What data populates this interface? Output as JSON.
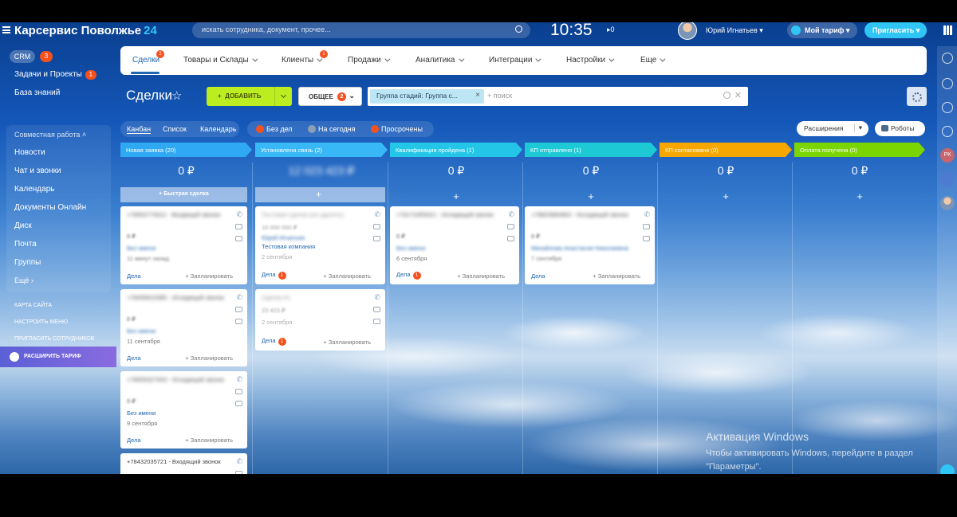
{
  "topbar": {
    "logo": "Карсервис Поволжье",
    "logo_num": "24",
    "search_placeholder": "искать сотрудника, документ, прочее...",
    "clock": "10:35",
    "flag_count": "0",
    "user_name": "Юрий Игнатьев",
    "tariff_label": "Мой тариф",
    "invite_label": "Пригласить"
  },
  "sidebar": {
    "crm_label": "CRM",
    "crm_badge": "3",
    "items": [
      {
        "label": "Задачи и Проекты",
        "badge": "1"
      },
      {
        "label": "База знаний"
      },
      {
        "label": "Совместная работа"
      },
      {
        "label": "Новости"
      },
      {
        "label": "Чат и звонки"
      },
      {
        "label": "Календарь"
      },
      {
        "label": "Документы Онлайн"
      },
      {
        "label": "Диск"
      },
      {
        "label": "Почта"
      },
      {
        "label": "Группы"
      },
      {
        "label": "Ещё"
      }
    ],
    "small_links": [
      "КАРТА САЙТА",
      "НАСТРОИТЬ МЕНЮ",
      "ПРИГЛАСИТЬ СОТРУДНИКОВ"
    ],
    "upgrade_label": "РАСШИРИТЬ ТАРИФ"
  },
  "nav": {
    "tabs": [
      {
        "label": "Сделки",
        "badge": "2"
      },
      {
        "label": "Товары и Склады"
      },
      {
        "label": "Клиенты",
        "badge": "1"
      },
      {
        "label": "Продажи"
      },
      {
        "label": "Аналитика"
      },
      {
        "label": "Интеграции"
      },
      {
        "label": "Настройки"
      },
      {
        "label": "Еще"
      }
    ]
  },
  "toolbar": {
    "title": "Сделки",
    "add_label": "ДОБАВИТЬ",
    "common_label": "ОБЩЕЕ",
    "common_badge": "2",
    "filter_tag": "Группа стадий: Группа с...",
    "filter_placeholder": "+ поиск"
  },
  "viewbar": {
    "views": [
      "Канбан",
      "Список",
      "Календарь"
    ],
    "counters": [
      {
        "label": "Без дел"
      },
      {
        "label": "На сегодня"
      },
      {
        "label": "Просрочены"
      }
    ],
    "extensions_label": "Расширения",
    "robots_label": "Роботы"
  },
  "columns": [
    {
      "name": "Новая заявка",
      "count": "(20)",
      "color": "#2fa9f4",
      "sum": "0 ₽"
    },
    {
      "name": "Установлена связь",
      "count": "(2)",
      "color": "#39b8f7",
      "sum": "12 023 423 ₽"
    },
    {
      "name": "Квалификация пройдена",
      "count": "(1)",
      "color": "#24c6e8",
      "sum": "0 ₽"
    },
    {
      "name": "КП отправлено",
      "count": "(1)",
      "color": "#1ec9d6",
      "sum": "0 ₽"
    },
    {
      "name": "КП согласовано",
      "count": "(0)",
      "color": "#f7a700",
      "sum": "0 ₽"
    },
    {
      "name": "Оплата получена",
      "count": "(0)",
      "color": "#7bd500",
      "sum": "0 ₽"
    }
  ],
  "quick_deal": "Быстрая сделка",
  "cards": {
    "c1": {
      "title": "+79002776311 - Входящий звонок",
      "sum": "0 ₽",
      "link": "Без имени",
      "date": "11 минут назад"
    },
    "c2": {
      "title": "+78435615385 - Исходящий звонок",
      "sum": "0 ₽",
      "link": "Без имени",
      "date": "11 сентября"
    },
    "c3": {
      "title": "+79505327403 - Исходящий звонок",
      "sum": "0 ₽",
      "link": "Без имени",
      "date": "9 сентября"
    },
    "c4": {
      "title": "+78432035721 - Входящий звонок"
    },
    "c5": {
      "title": "Тестовая сделка (не удалять)",
      "sum": "10 000 000 ₽",
      "link": "Юрий Игнатьев",
      "link_b": "Тестовая компания",
      "date": "2 сентября"
    },
    "c6": {
      "title": "Сделка #1",
      "sum": "23 423 ₽",
      "date": "2 сентября"
    },
    "c7": {
      "title": "+79172455321 - Исходящий звонок",
      "sum": "0 ₽",
      "link": "Без имени",
      "date": "6 сентября"
    },
    "c8": {
      "title": "+79603984963 - Исходящий звонок",
      "sum": "0 ₽",
      "link": "Михайлова Анастасия Николаевна",
      "date": "7 сентября"
    },
    "deals_label": "Дела",
    "plan_label": "+ Запланировать",
    "deal_badge": "1"
  },
  "rail": {
    "avatar_initials": "РК"
  },
  "watermark": {
    "title": "Активация Windows",
    "text": "Чтобы активировать Windows, перейдите в раздел \"Параметры\"."
  }
}
